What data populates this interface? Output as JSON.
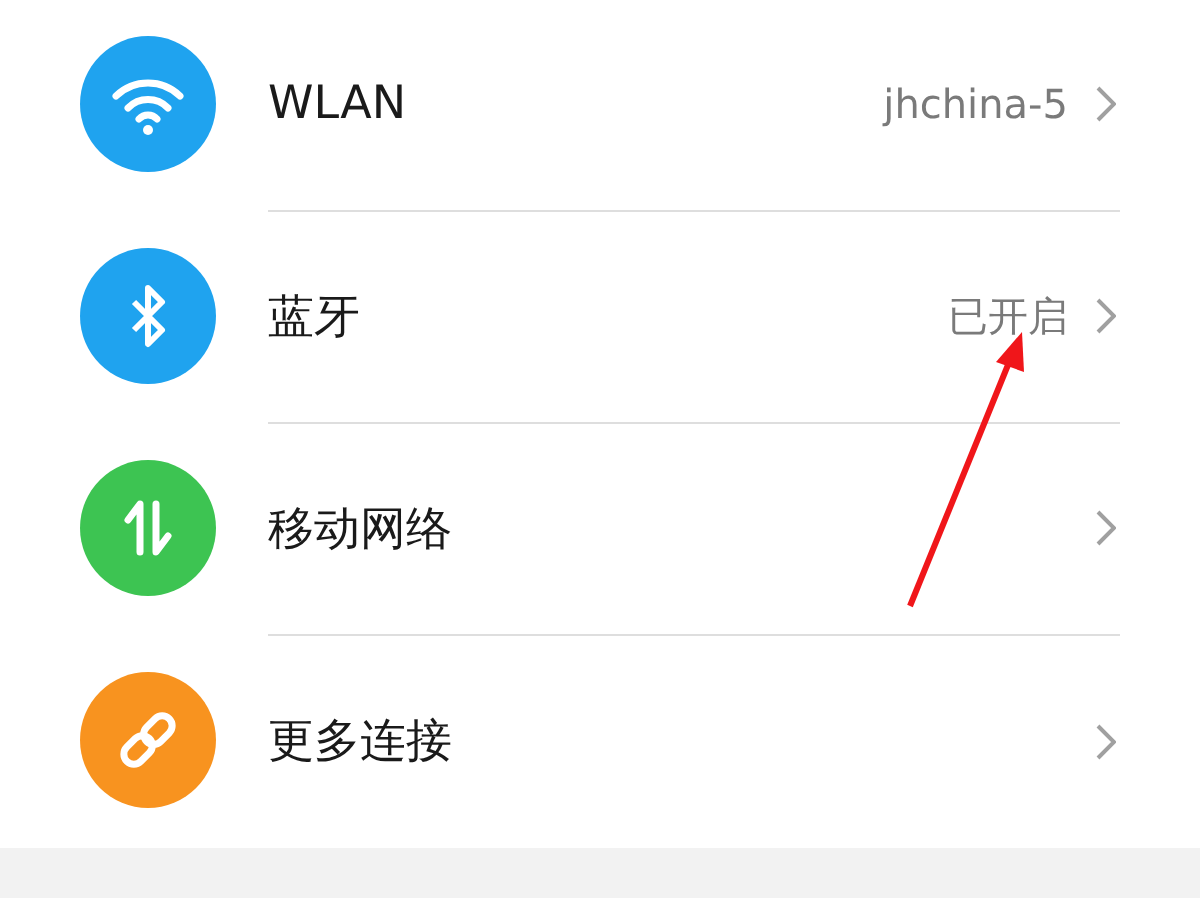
{
  "settings": [
    {
      "kind": "wifi",
      "color": "#1fa3ef",
      "label": "WLAN",
      "value": "jhchina-5"
    },
    {
      "kind": "bluetooth",
      "color": "#1fa3ef",
      "label": "蓝牙",
      "value": "已开启"
    },
    {
      "kind": "mobile",
      "color": "#3dc452",
      "label": "移动网络"
    },
    {
      "kind": "link",
      "color": "#f8931f",
      "label": "更多连接"
    }
  ]
}
